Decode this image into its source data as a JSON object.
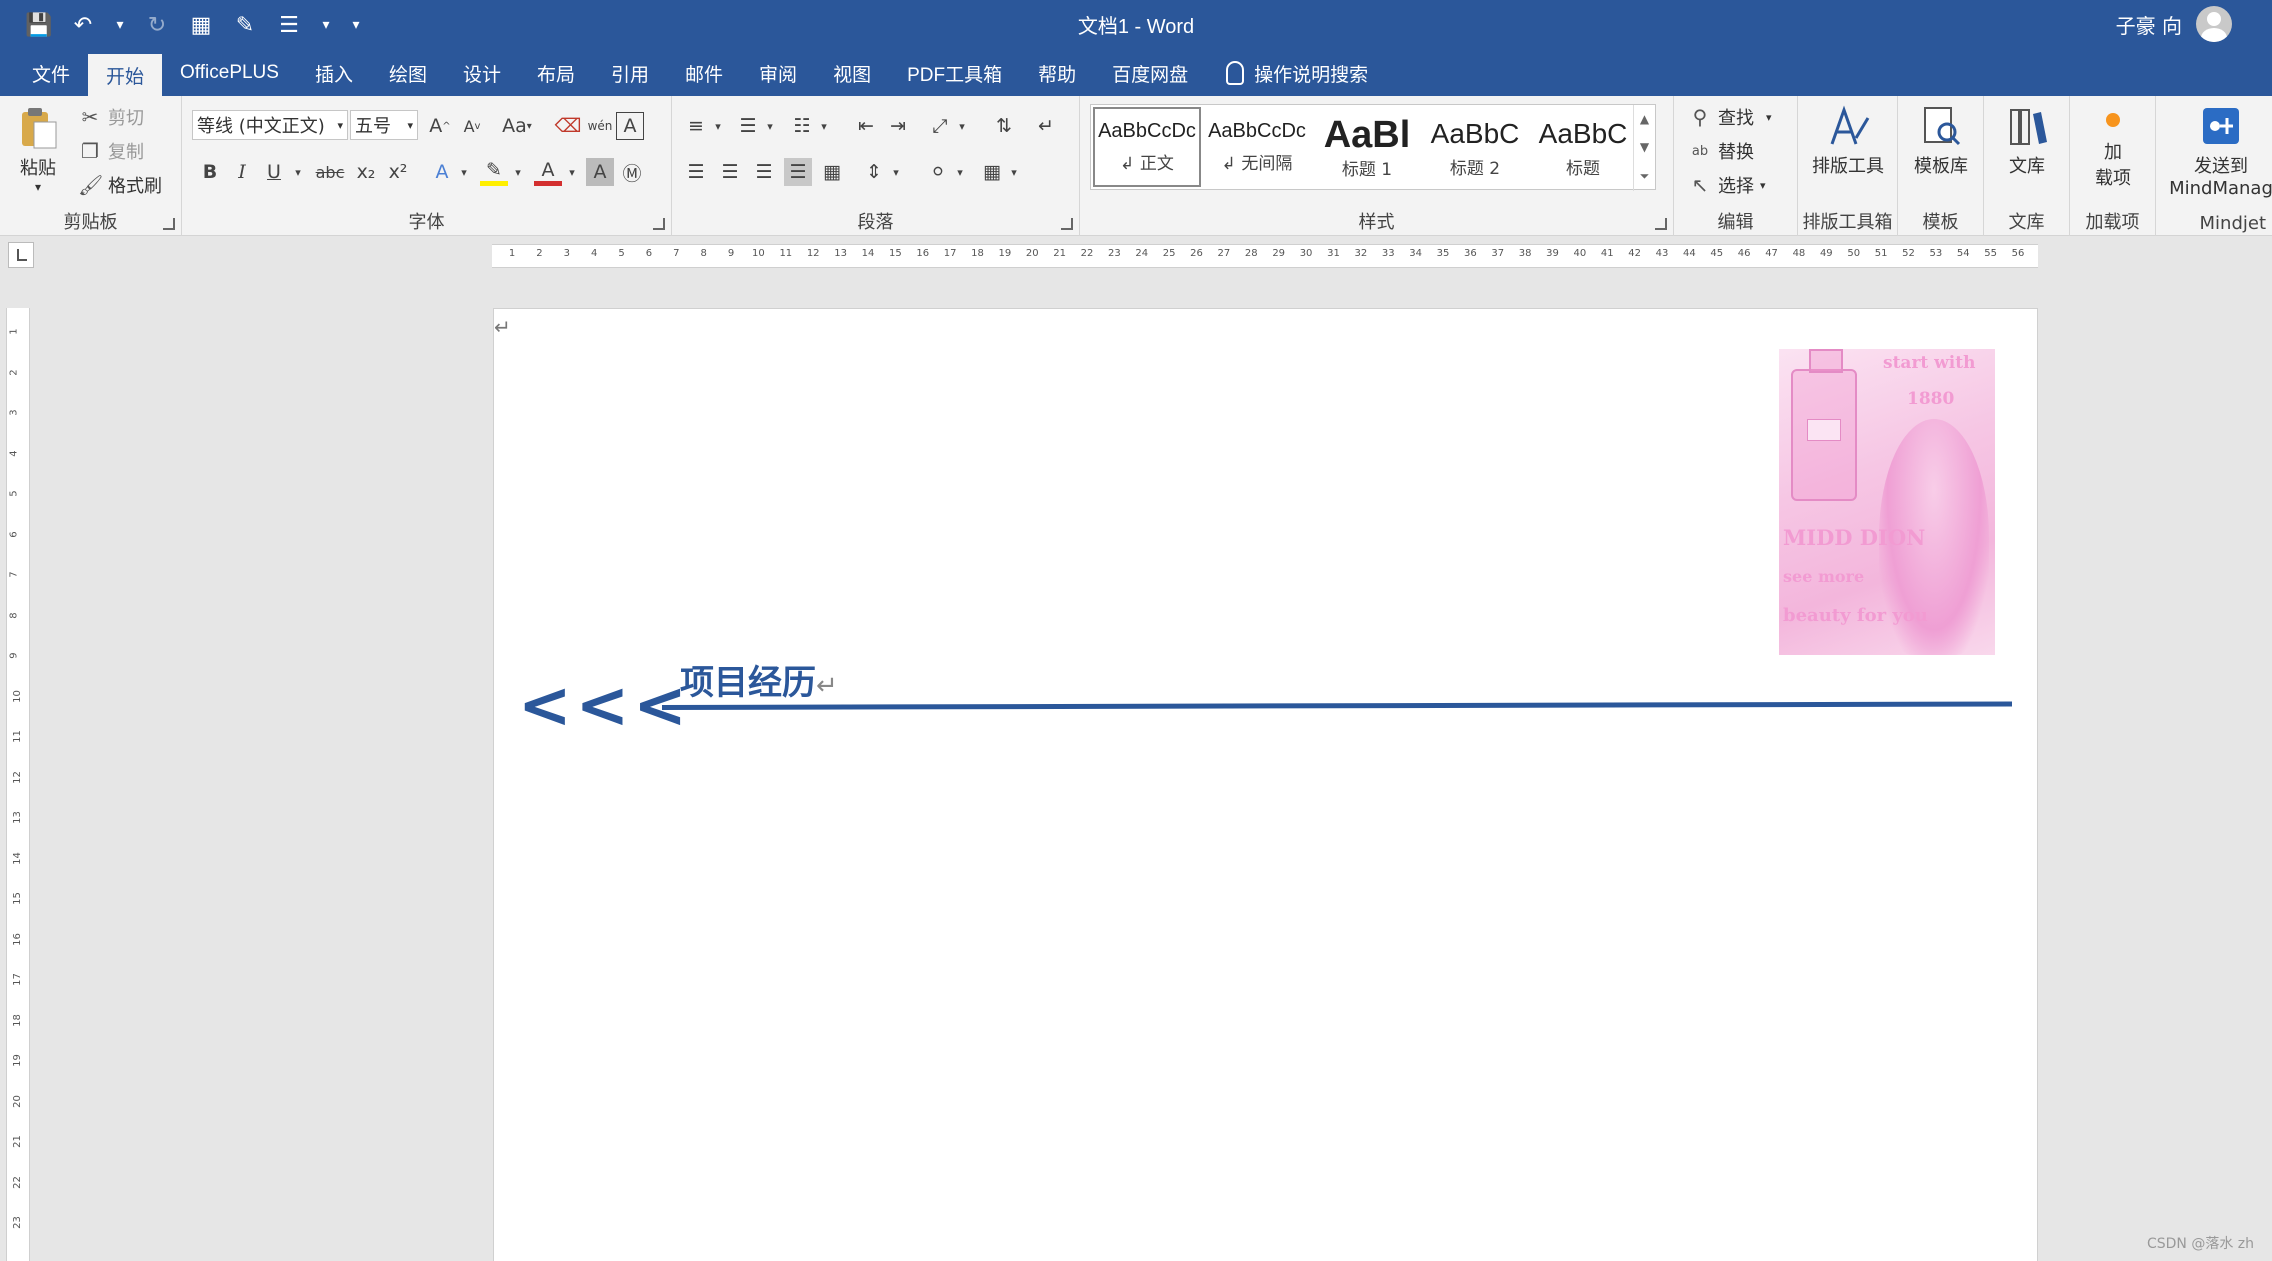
{
  "window": {
    "doc_name": "文档1",
    "separator": "-",
    "app_name": "Word"
  },
  "user": {
    "name": "子豪 向"
  },
  "menu": {
    "tabs": [
      {
        "label": "文件"
      },
      {
        "label": "开始"
      },
      {
        "label": "OfficePLUS"
      },
      {
        "label": "插入"
      },
      {
        "label": "绘图"
      },
      {
        "label": "设计"
      },
      {
        "label": "布局"
      },
      {
        "label": "引用"
      },
      {
        "label": "邮件"
      },
      {
        "label": "审阅"
      },
      {
        "label": "视图"
      },
      {
        "label": "PDF工具箱"
      },
      {
        "label": "帮助"
      },
      {
        "label": "百度网盘"
      }
    ],
    "active_index": 1,
    "search_label": "操作说明搜索"
  },
  "ribbon": {
    "clipboard": {
      "label": "剪贴板",
      "paste": "粘贴",
      "cut": "剪切",
      "copy": "复制",
      "format_painter": "格式刷"
    },
    "font": {
      "label": "字体",
      "font_name": "等线 (中文正文)",
      "font_size": "五号",
      "change_case": "Aa",
      "bold": "B",
      "italic": "I",
      "underline": "U",
      "strike": "abc",
      "subscript": "x₂",
      "superscript": "x²",
      "effects": "A",
      "font_color": "A",
      "char_shading": "A",
      "phonetic": "wén",
      "char_border": "A"
    },
    "paragraph": {
      "label": "段落"
    },
    "styles": {
      "label": "样式",
      "items": [
        {
          "sample": "AaBbCcDc",
          "name": "↲ 正文"
        },
        {
          "sample": "AaBbCcDc",
          "name": "↲ 无间隔"
        },
        {
          "sample": "AaBl",
          "name": "标题 1"
        },
        {
          "sample": "AaBbC",
          "name": "标题 2"
        },
        {
          "sample": "AaBbC",
          "name": "标题"
        }
      ]
    },
    "editing": {
      "label": "编辑",
      "find": "查找",
      "replace": "替换",
      "select": "选择"
    },
    "layout_tools": {
      "label": "排版工具箱",
      "button": "排版工具"
    },
    "template": {
      "label": "模板",
      "button": "模板库"
    },
    "library": {
      "label": "文库",
      "button": "文库"
    },
    "addins": {
      "label": "加载项",
      "button_line1": "加",
      "button_line2": "载项"
    },
    "mindjet": {
      "label": "Mindjet",
      "button_line1": "发送到",
      "button_line2": "MindManag"
    }
  },
  "ruler": {
    "h_ticks": [
      "1",
      "2",
      "3",
      "4",
      "5",
      "6",
      "7",
      "8",
      "9",
      "10",
      "11",
      "12",
      "13",
      "14",
      "15",
      "16",
      "17",
      "18",
      "19",
      "20",
      "21",
      "22",
      "23",
      "24",
      "25",
      "26",
      "27",
      "28",
      "29",
      "30",
      "31",
      "32",
      "33",
      "34",
      "35",
      "36",
      "37",
      "38",
      "39",
      "40",
      "41",
      "42",
      "43",
      "44",
      "45",
      "46",
      "47",
      "48",
      "49",
      "50",
      "51",
      "52",
      "53",
      "54",
      "55",
      "56"
    ],
    "v_ticks": [
      "1",
      "2",
      "3",
      "4",
      "5",
      "6",
      "7",
      "8",
      "9",
      "10",
      "11",
      "12",
      "13",
      "14",
      "15",
      "16",
      "17",
      "18",
      "19",
      "20",
      "21",
      "22",
      "23"
    ]
  },
  "document": {
    "heading_arrows": "<<<",
    "heading_title": "项目经历",
    "paragraph_mark": "↵",
    "photo_texts": {
      "line1": "start with",
      "line2": "1880",
      "line3": "MIDD DION",
      "line4": "see more",
      "line5": "beauty for you"
    },
    "accent_color": "#2b579a"
  },
  "watermark": "CSDN @落水 zh"
}
